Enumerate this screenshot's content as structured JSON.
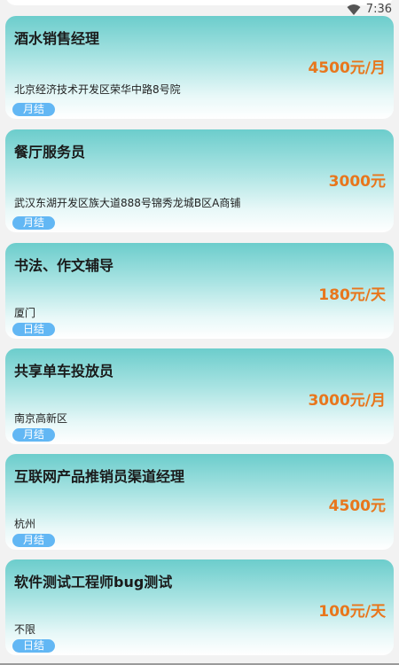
{
  "status_bar": {
    "time": "7:36",
    "wifi_icon": "wifi-icon"
  },
  "peek_card": {
    "badge": "月结"
  },
  "jobs": [
    {
      "title": "酒水销售经理",
      "salary": "4500元/月",
      "address": "北京经济技术开发区荣华中路8号院",
      "badge": "月结"
    },
    {
      "title": "餐厅服务员",
      "salary": "3000元",
      "address": "武汉东湖开发区族大道888号锦秀龙城B区A商铺",
      "badge": "月结"
    },
    {
      "title": "书法、作文辅导",
      "salary": "180元/天",
      "address": "厦门",
      "badge": "日结"
    },
    {
      "title": "共享单车投放员",
      "salary": "3000元/月",
      "address": "南京高新区",
      "badge": "月结"
    },
    {
      "title": "互联网产品推销员渠道经理",
      "salary": "4500元",
      "address": "杭州",
      "badge": "月结"
    },
    {
      "title": "软件测试工程师bug测试",
      "salary": "100元/天",
      "address": "不限",
      "badge": "日结"
    }
  ],
  "colors": {
    "salary": "#e8761c",
    "badge_bg": "#62b7f4",
    "card_top": "#6ccdcc"
  }
}
